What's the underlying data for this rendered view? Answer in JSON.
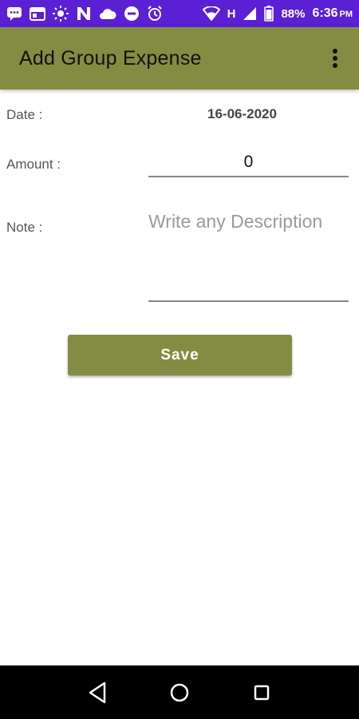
{
  "status_bar": {
    "battery_percent": "88%",
    "time": "6:36",
    "ampm": "PM",
    "network": "H",
    "icons": [
      "chat-icon",
      "calendar-icon",
      "brightness-icon",
      "n-icon",
      "cloud-icon",
      "dnd-icon",
      "alarm-icon",
      "wifi-icon",
      "signal-icon",
      "battery-icon"
    ]
  },
  "app_bar": {
    "title": "Add Group Expense",
    "overflow_icon": "more-vert-icon"
  },
  "form": {
    "date_label": "Date :",
    "date_value": "16-06-2020",
    "amount_label": "Amount :",
    "amount_value": "0",
    "note_label": "Note :",
    "note_placeholder": "Write any Description"
  },
  "save_button": {
    "label": "Save"
  },
  "colors": {
    "status_bar": "#5b1fd4",
    "primary": "#848c43",
    "nav_bar": "#000000"
  },
  "nav_bar": {
    "icons": [
      "back-icon",
      "home-icon",
      "recents-icon"
    ]
  }
}
